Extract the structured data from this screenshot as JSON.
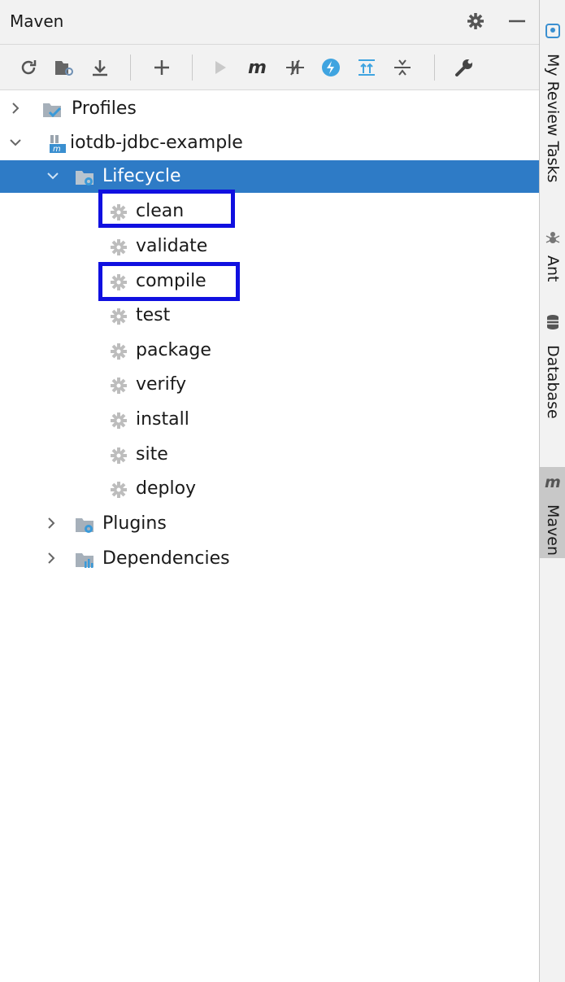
{
  "panel": {
    "title": "Maven"
  },
  "tree": {
    "profiles": "Profiles",
    "project": "iotdb-jdbc-example",
    "lifecycle": "Lifecycle",
    "goals": [
      "clean",
      "validate",
      "compile",
      "test",
      "package",
      "verify",
      "install",
      "site",
      "deploy"
    ],
    "plugins": "Plugins",
    "dependencies": "Dependencies"
  },
  "highlighted_goals": [
    "clean",
    "compile"
  ],
  "sidebar": {
    "tabs": [
      "My Review Tasks",
      "Ant",
      "Database",
      "Maven"
    ],
    "active_tab": "Maven"
  },
  "colors": {
    "selection": "#2e7bc6",
    "highlight_box": "#1010e0",
    "panel_bg": "#ffffff",
    "header_bg": "#f2f2f2"
  }
}
